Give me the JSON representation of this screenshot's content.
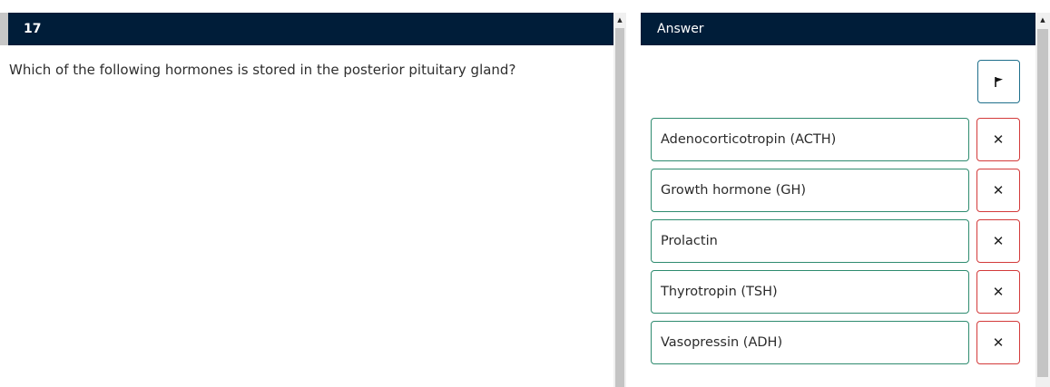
{
  "question": {
    "number": "17",
    "text": "Which of the following hormones is stored in the posterior pituitary gland?"
  },
  "answer_panel": {
    "title": "Answer",
    "flag_icon": "flag-icon",
    "remove_icon": "close-icon",
    "remove_glyph": "✕",
    "options": [
      {
        "label": "Adenocorticotropin (ACTH)"
      },
      {
        "label": "Growth hormone (GH)"
      },
      {
        "label": "Prolactin"
      },
      {
        "label": "Thyrotropin (TSH)"
      },
      {
        "label": "Vasopressin (ADH)"
      }
    ]
  },
  "colors": {
    "header_bg": "#001d39",
    "option_border": "#2e8b6f",
    "remove_border": "#d33a3a",
    "flag_border": "#1f6f8b"
  }
}
